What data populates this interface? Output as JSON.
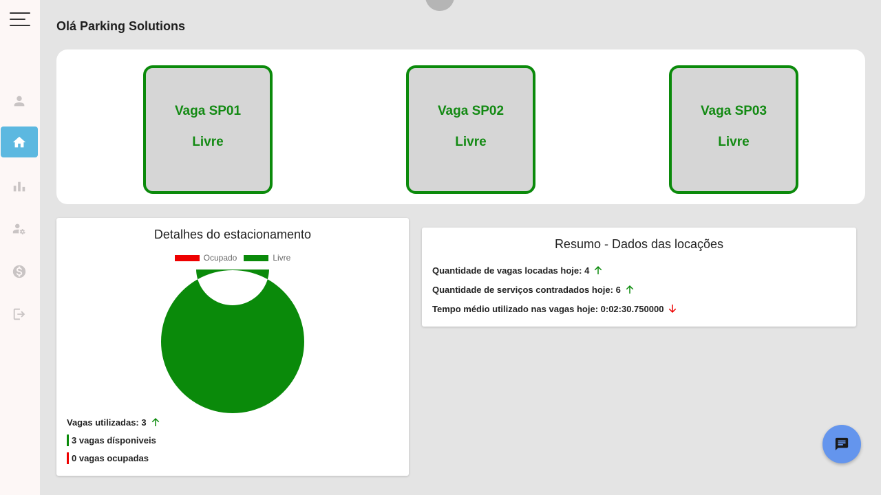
{
  "header": {
    "title": "Olá Parking Solutions"
  },
  "sidebar": {
    "items": [
      {
        "name": "user",
        "icon": "person-icon",
        "active": false
      },
      {
        "name": "home",
        "icon": "home-icon",
        "active": true
      },
      {
        "name": "reports",
        "icon": "bar-chart-icon",
        "active": false
      },
      {
        "name": "user-settings",
        "icon": "user-gear-icon",
        "active": false
      },
      {
        "name": "payments",
        "icon": "dollar-icon",
        "active": false
      },
      {
        "name": "logout",
        "icon": "logout-icon",
        "active": false
      }
    ]
  },
  "spots": [
    {
      "name": "Vaga SP01",
      "status": "Livre"
    },
    {
      "name": "Vaga SP02",
      "status": "Livre"
    },
    {
      "name": "Vaga SP03",
      "status": "Livre"
    }
  ],
  "details": {
    "title": "Detalhes do estacionamento",
    "legend": [
      {
        "label": "Ocupado",
        "color": "#ee0000"
      },
      {
        "label": "Livre",
        "color": "#0a8a0a"
      }
    ],
    "stats": {
      "used_label": "Vagas utilizadas: 3",
      "available_label": "3 vagas dísponiveis",
      "occupied_label": "0 vagas ocupadas"
    }
  },
  "chart_data": {
    "type": "pie",
    "categories": [
      "Ocupado",
      "Livre"
    ],
    "values": [
      0,
      3
    ],
    "colors": [
      "#ee0000",
      "#0a8a0a"
    ],
    "legend": "top"
  },
  "summary": {
    "title": "Resumo - Dados das locações",
    "lines": [
      {
        "text": "Quantidade de vagas locadas hoje: 4",
        "trend": "up"
      },
      {
        "text": "Quantidade de serviços contradados hoje: 6",
        "trend": "up"
      },
      {
        "text": "Tempo médio utilizado nas vagas hoje: 0:02:30.750000",
        "trend": "down"
      }
    ]
  },
  "colors": {
    "accent": "#5cb8e0",
    "free": "#0a8a0a",
    "occupied": "#ee0000",
    "chat": "#6495ed"
  },
  "chat": {
    "icon": "chat-icon"
  }
}
